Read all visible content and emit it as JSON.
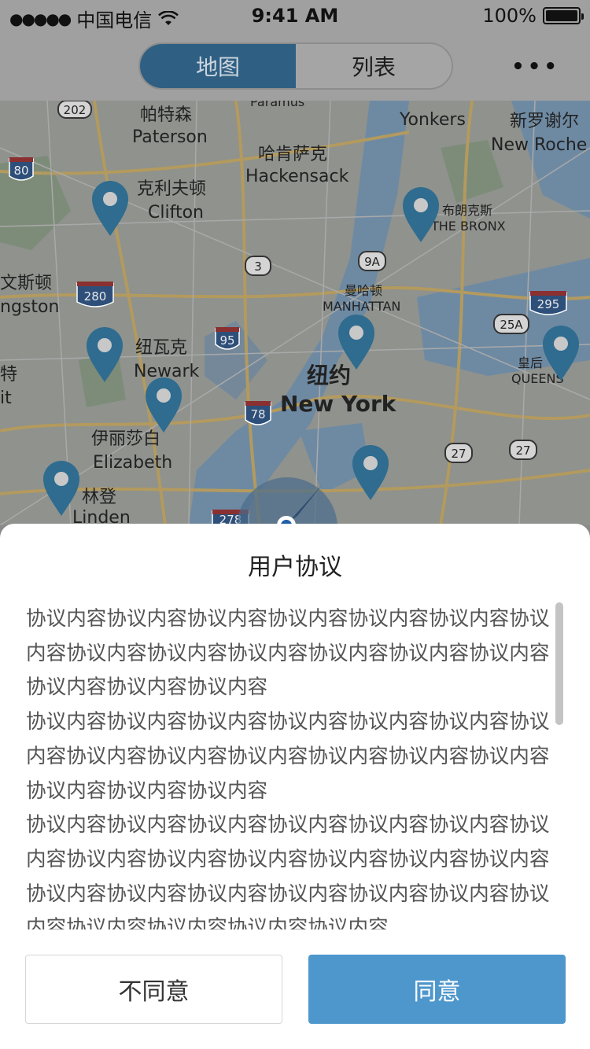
{
  "status_bar": {
    "signal": "●●●●●",
    "carrier": "中国电信",
    "time": "9:41 AM",
    "battery": "100%"
  },
  "nav": {
    "tabs": [
      {
        "label": "地图",
        "active": true
      },
      {
        "label": "列表",
        "active": false
      }
    ],
    "more": "•••"
  },
  "map": {
    "labels": {
      "paramus": "Paramus",
      "paterson_cn": "帕特森",
      "paterson_en": "Paterson",
      "hackensack_cn": "哈肯萨克",
      "hackensack_en": "Hackensack",
      "clifton_cn": "克利夫顿",
      "clifton_en": "Clifton",
      "yonkers": "Yonkers",
      "newrochelle_cn": "新罗谢尔",
      "newrochelle_en": "New Roche",
      "bronx_cn": "布朗克斯",
      "bronx_en": "THE BRONX",
      "manhattan_cn": "曼哈顿",
      "manhattan_en": "MANHATTAN",
      "livingston_cn": "文斯顿",
      "livingston_en": "ngston",
      "newark_cn": "纽瓦克",
      "newark_en": "Newark",
      "newyork_cn": "纽约",
      "newyork_en": "New York",
      "queens_cn": "皇后",
      "queens_en": "QUEENS",
      "elizabeth_cn": "伊丽莎白",
      "elizabeth_en": "Elizabeth",
      "linden_cn": "林登",
      "linden_en": "Linden",
      "edge_cn": "特",
      "edge_en": "it"
    },
    "shields": {
      "r202": "202",
      "i80": "80",
      "r3": "3",
      "r9a": "9A",
      "i280": "280",
      "i95": "95",
      "i295": "295",
      "r25a": "25A",
      "i78": "78",
      "r27a": "27",
      "r27b": "27",
      "i278": "278"
    }
  },
  "dialog": {
    "title": "用户协议",
    "paragraphs": [
      "协议内容协议内容协议内容协议内容协议内容协议内容协议内容协议内容协议内容协议内容协议内容协议内容协议内容协议内容协议内容协议内容",
      "协议内容协议内容协议内容协议内容协议内容协议内容协议内容协议内容协议内容协议内容协议内容协议内容协议内容协议内容协议内容协议内容",
      "协议内容协议内容协议内容协议内容协议内容协议内容协议内容协议内容协议内容协议内容协议内容协议内容协议内容协议内容协议内容协议内容协议内容协议内容协议内容协议内容协议内容协议内容协议内容协议内容"
    ],
    "disagree_label": "不同意",
    "agree_label": "同意"
  },
  "colors": {
    "accent": "#4e97cc",
    "segment_active": "#2f5f82",
    "pin": "#2f6c8f"
  }
}
